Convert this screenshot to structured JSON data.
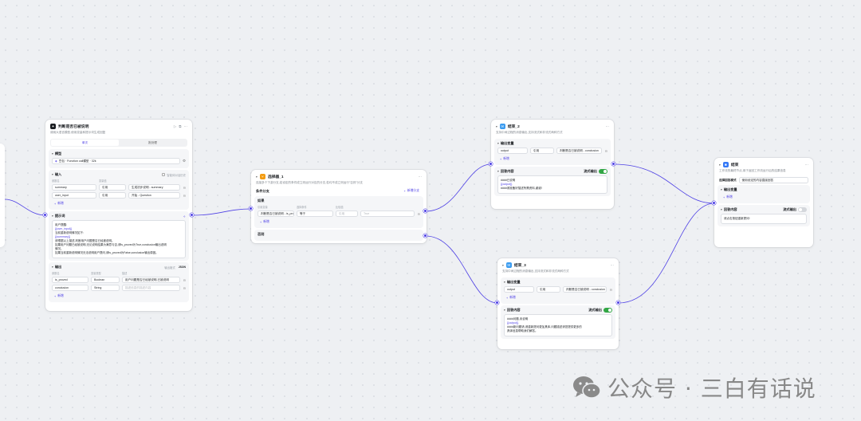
{
  "llm_node": {
    "title": "判断是否已被说明",
    "desc": "调用大语言模型,使用变量和提示词生成回复",
    "tabs": [
      "单次",
      "批处理"
    ],
    "model_label": "模型",
    "model_value": "豆包 · Function call模型 · 32k",
    "input_label": "输入",
    "input_tip": "智能体对话历史",
    "col_name": "参数名",
    "col_value": "变量值",
    "inputs": [
      {
        "name": "summary",
        "type": "引用",
        "value": "生成初步说明 - summary"
      },
      {
        "name": "user_input",
        "type": "引用",
        "value": "开始 - Question"
      }
    ],
    "add_label": "新增",
    "prompt_label": "提示词",
    "prompt_lines": [
      "用户提醒:",
      "{{user_input}}",
      "当前重新说明情况如下:",
      "{{summary}}",
      "请根据以上描述,判断用户问题是否已经被说明。",
      "如果用户问题已经被说明,无论说明结果为满意与否,请is_proved为True,conclusion输出说明",
      "情况。",
      "如果当前重新说明情况无法说明用户提问,请is_proved为False,conclusion输出原因。"
    ],
    "output_label": "输出",
    "output_format": "输出格式",
    "output_format_value": "JSON",
    "col_type": "变量类型",
    "col_desc": "描述",
    "outputs": [
      {
        "name": "is_proved",
        "type": "Boolean",
        "desc": "用户问题是否已经被说明,已被说明"
      },
      {
        "name": "conclusion",
        "type": "String",
        "desc": "描述信息的描述内容"
      }
    ]
  },
  "cond_node": {
    "title": "选择器_1",
    "desc": "连接多个下游分支,若设定的条件成立则运行对应的分支,若均不成立则运行\"否则\"分支",
    "section_label": "条件分支",
    "add_cond": "新增分支",
    "if_label": "如果",
    "col_var": "引用变量",
    "col_op": "选择条件",
    "col_cmp": "比较值",
    "var_value": "判断是否已被说明 - is_proved",
    "op_value": "等于",
    "cmp_type": "引用",
    "cmp_value": "True",
    "else_label": "否则"
  },
  "msg_top": {
    "title": "结束_2",
    "desc": "支持中间过程的消息输出,支持流式和非流式两种方式",
    "output_label": "输出变量",
    "row_name": "output",
    "row_type": "引用",
    "row_value": "判断是否已被说明 - conclusion",
    "add_label": "新增",
    "reply_label": "回答内容",
    "stream_label": "流式输出",
    "reply_lines": [
      "####已说明",
      "{{output}}",
      "####请准备好描述所需资料,谢谢!"
    ]
  },
  "msg_bottom": {
    "title": "结束_3",
    "desc": "支持中间过程的消息输出,支持流式和非流式两种方式",
    "output_label": "输出变量",
    "row_name": "output",
    "row_type": "引用",
    "row_value": "判断是否已被说明 - conclusion",
    "add_label": "新增",
    "reply_label": "回答内容",
    "stream_label": "流式输出",
    "reply_lines": [
      "####问题,未说明",
      "{{output}}",
      "####新问题请,请重新提问更加具体,问题描述请您提供更多的",
      "具体信息帮助我们解答。"
    ]
  },
  "end_node": {
    "title": "结束",
    "desc": "工作流的最终节点,用于返回工作流运行后的结果信息",
    "mode_label": "选择回答模式",
    "mode_value": "使用设定的内容直接回答",
    "output_label": "输出变量",
    "add_label": "新增",
    "reply_label": "回答内容",
    "stream_label": "流式输出",
    "reply_text": "请点击按钮重新提问!"
  },
  "watermark": {
    "text": "公众号 · 三白有话说"
  },
  "colors": {
    "accent": "#4e40e5",
    "toggle_on": "#32a645",
    "llm_icon": "#1c1f23",
    "cond_icon": "#f39c12",
    "msg_icon": "#3b9cf0",
    "end_icon": "#3478f6"
  }
}
